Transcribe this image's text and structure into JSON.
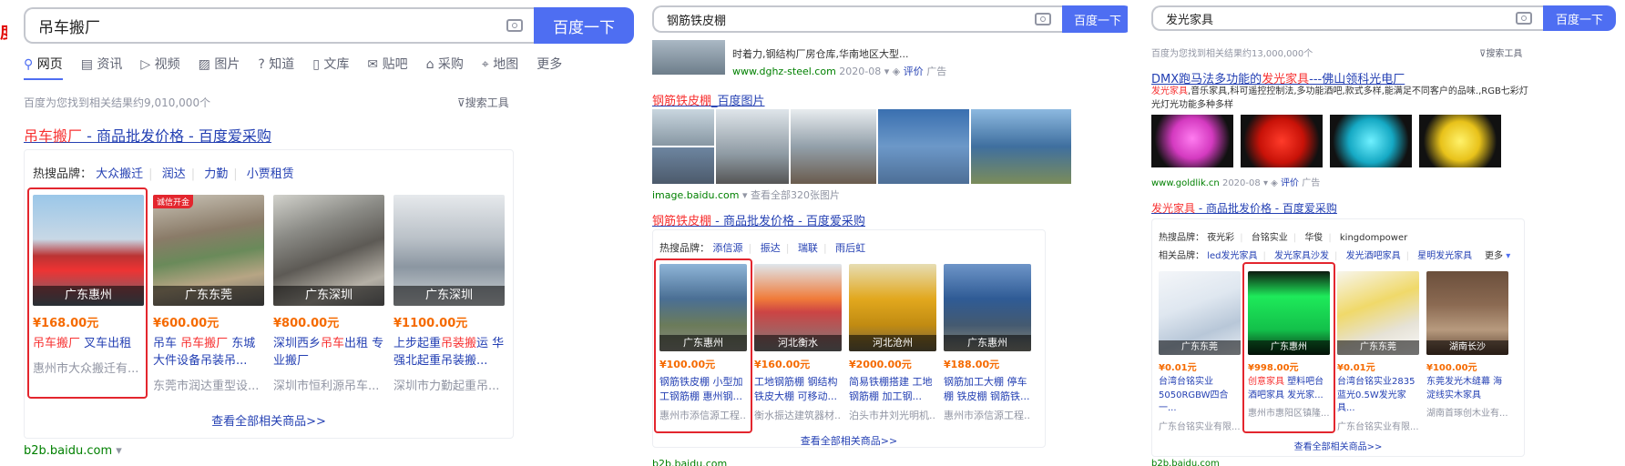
{
  "colors": {
    "accent": "#4e6ef2",
    "link": "#2440b3",
    "highlight": "#f73131",
    "price": "#f56a00",
    "selection": "#e3262e",
    "source": "#008000"
  },
  "panel1": {
    "edge_char": "度",
    "query": "吊车搬厂",
    "search_button": "百度一下",
    "tabs": [
      "网页",
      "资讯",
      "视频",
      "图片",
      "知道",
      "文库",
      "贴吧",
      "采购",
      "地图",
      "更多"
    ],
    "result_count": "百度为您找到相关结果约9,010,000个",
    "search_tools": "搜索工具",
    "title_em": "吊车搬厂",
    "title_rest": " - 商品批发价格 - 百度爱采购",
    "hot_label": "热搜品牌：",
    "hot_brands": [
      "大众搬迁",
      "润达",
      "力勤",
      "小贾租赁"
    ],
    "products": [
      {
        "loc": "广东惠州",
        "price": "¥168.00元",
        "name_em": "吊车搬厂",
        "name_rest": " 叉车出租",
        "company": "惠州市大众搬迁有..."
      },
      {
        "loc": "广东东莞",
        "price": "¥600.00元",
        "badge": "诚信开金",
        "name_em": "吊车搬厂",
        "name_prefix": "吊车 ",
        "name_rest": " 东城大件设备吊装吊...",
        "company": "东莞市润达重型设..."
      },
      {
        "loc": "广东深圳",
        "price": "¥800.00元",
        "name_prefix": "深圳西乡",
        "name_em": "吊车",
        "name_rest": "出租 专业搬厂",
        "company": "深圳市恒利源吊车..."
      },
      {
        "loc": "广东深圳",
        "price": "¥1100.00元",
        "name_prefix": "上步起重",
        "name_em": "吊装搬",
        "name_rest": "运 华强北起重吊装搬...",
        "company": "深圳市力勤起重吊..."
      }
    ],
    "more_link": "查看全部相关商品>>",
    "source": "b2b.baidu.com"
  },
  "panel2": {
    "query": "钢筋铁皮棚",
    "search_button": "百度一下",
    "prev_snippet": "时着力,钢结构厂房仓库,华南地区大型...",
    "prev_source": "www.dghz-steel.com",
    "prev_date": "2020-08",
    "prev_eval": "评价",
    "prev_ad": "广告",
    "img_title_em": "钢筋铁皮棚",
    "img_title_rest": "_百度图片",
    "img_source": "image.baidu.com",
    "img_more": "查看全部320张图片",
    "title_em": "钢筋铁皮棚",
    "title_rest": " - 商品批发价格 - 百度爱采购",
    "hot_label": "热搜品牌：",
    "hot_brands": [
      "添信源",
      "振达",
      "瑞联",
      "雨后虹"
    ],
    "products": [
      {
        "loc": "广东惠州",
        "price": "¥100.00元",
        "name": "钢筋铁皮棚 小型加工钢筋棚 惠州钢...",
        "company": "惠州市添信源工程..."
      },
      {
        "loc": "河北衡水",
        "price": "¥160.00元",
        "name": "工地钢筋棚 钢结构铁皮大棚 可移动...",
        "company": "衡水振达建筑器材..."
      },
      {
        "loc": "河北沧州",
        "price": "¥2000.00元",
        "name": "简易铁棚搭建 工地钢筋棚 加工钢...",
        "company": "泊头市井刘光明机..."
      },
      {
        "loc": "广东惠州",
        "price": "¥188.00元",
        "name": "钢筋加工大棚 停车棚 铁皮棚 钢筋铁...",
        "company": "惠州市添信源工程..."
      }
    ],
    "more_link": "查看全部相关商品>>",
    "source": "b2b.baidu.com"
  },
  "panel3": {
    "query": "发光家具",
    "search_button": "百度一下",
    "result_count": "百度为您找到相关结果约13,000,000个",
    "search_tools": "搜索工具",
    "ad_title_prefix": "DMX跑马法多功能的",
    "ad_title_em": "发光家具",
    "ad_title_rest": "---佛山领科光电厂",
    "ad_desc_em": "发光家具",
    "ad_desc_rest": ",音乐家具,科可遥控控制法,多功能酒吧,款式多样,能满足不同客户的品味.,RGB七彩灯光灯光功能多种多样",
    "ad_source": "www.goldlik.cn",
    "ad_date": "2020-08",
    "ad_eval": "评价",
    "ad_ad": "广告",
    "title_em": "发光家具",
    "title_rest": " - 商品批发价格 - 百度爱采购",
    "hot_label": "热搜品牌：",
    "hot_brands": [
      "夜光彩",
      "台铭实业",
      "华俊",
      "kingdompower"
    ],
    "rel_label": "相关品牌：",
    "rel_brands": [
      "led发光家具",
      "发光家具沙发",
      "发光酒吧家具",
      "星明发光家具"
    ],
    "rel_more": "更多",
    "products": [
      {
        "loc": "广东东莞",
        "price": "¥0.01元",
        "name": "台湾台铭实业5050RGBW四合一...",
        "company": "广东台铭实业有限..."
      },
      {
        "loc": "广东惠州",
        "price": "¥998.00元",
        "name_em": "创意家具",
        "name_rest": " 塑料吧台酒吧家具 发光家...",
        "company": "惠州市惠阳区镇隆..."
      },
      {
        "loc": "广东东莞",
        "price": "¥0.01元",
        "name": "台湾台铭实业2835蓝光0.5W发光家具...",
        "company": "广东台铭实业有限..."
      },
      {
        "loc": "湖南长沙",
        "price": "¥100.00元",
        "name": "东莞发光木缝幕 海淀线实木家具",
        "company": "湖南首琢创木业有..."
      }
    ],
    "more_link": "查看全部相关商品>>",
    "source": "b2b.baidu.com"
  }
}
